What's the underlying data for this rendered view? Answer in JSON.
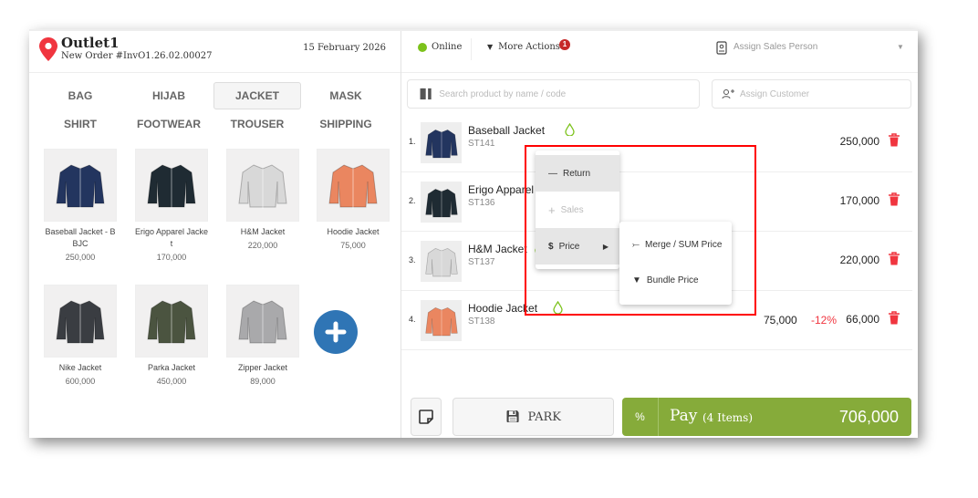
{
  "header": {
    "outlet": "Outlet1",
    "order": "New Order #InvO1.26.02.00027",
    "date": "15 February 2026",
    "status": "Online",
    "more_actions": "More Actions",
    "notif_count": "1",
    "sales_person_placeholder": "Assign Sales Person"
  },
  "categories": [
    "BAG",
    "HIJAB",
    "JACKET",
    "MASK",
    "SHIRT",
    "FOOTWEAR",
    "TROUSER",
    "SHIPPING"
  ],
  "active_category": "JACKET",
  "products": [
    {
      "name": "Baseball Jacket - B BJC",
      "price": "250,000",
      "color": "#23355f"
    },
    {
      "name": "Erigo Apparel Jacke t",
      "price": "170,000",
      "color": "#1f2b33"
    },
    {
      "name": "H&M Jacket",
      "price": "220,000",
      "color": "#d8d8d8"
    },
    {
      "name": "Hoodie Jacket",
      "price": "75,000",
      "color": "#ea8660"
    },
    {
      "name": "Nike Jacket",
      "price": "600,000",
      "color": "#3a3d42"
    },
    {
      "name": "Parka Jacket",
      "price": "450,000",
      "color": "#4b5440"
    },
    {
      "name": "Zipper Jacket",
      "price": "89,000",
      "color": "#a9a9ab"
    }
  ],
  "search": {
    "placeholder": "Search product by name / code",
    "customer_placeholder": "Assign Customer"
  },
  "cart": [
    {
      "num": "1.",
      "name": "Baseball Jacket",
      "code": "ST141",
      "price": "",
      "discount": "",
      "total": "250,000",
      "color": "#23355f"
    },
    {
      "num": "2.",
      "name": "Erigo Apparel J",
      "code": "ST136",
      "price": "",
      "discount": "",
      "total": "170,000",
      "color": "#1f2b33"
    },
    {
      "num": "3.",
      "name": "H&M Jacket",
      "code": "ST137",
      "price": "",
      "discount": "",
      "total": "220,000",
      "color": "#d8d8d8"
    },
    {
      "num": "4.",
      "name": "Hoodie Jacket",
      "code": "ST138",
      "price": "75,000",
      "discount": "-12%",
      "total": "66,000",
      "color": "#ea8660"
    }
  ],
  "context_menu": {
    "return": "Return",
    "sales": "Sales",
    "price": "Price",
    "merge": "Merge / SUM Price",
    "bundle": "Bundle Price"
  },
  "footer": {
    "park": "PARK",
    "percent": "%",
    "pay": "Pay",
    "items": "(4 Items)",
    "total": "706,000"
  },
  "colors": {
    "accent": "#86ab3a",
    "danger": "#f0353f",
    "online": "#7cc21b",
    "highlight": "#ff0000",
    "fab": "#2f75b5"
  }
}
